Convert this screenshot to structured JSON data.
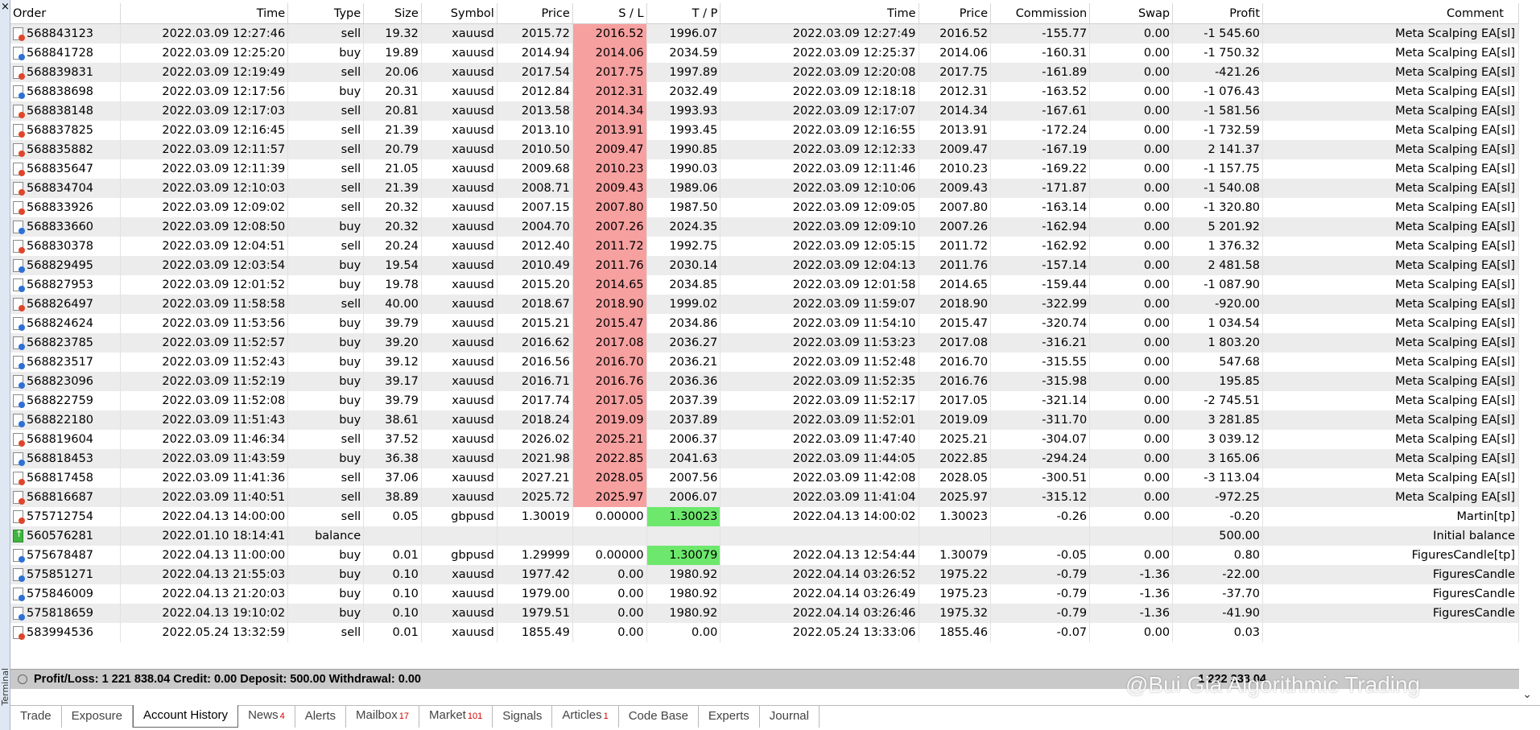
{
  "sidebar": {
    "close_glyph": "×",
    "label": "Terminal"
  },
  "columns": [
    "Order",
    "Time",
    "Type",
    "Size",
    "Symbol",
    "Price",
    "S / L",
    "T / P",
    "Time",
    "Price",
    "Commission",
    "Swap",
    "Profit",
    "Comment"
  ],
  "rows": [
    {
      "icon": "red",
      "order": "568843123",
      "time": "2022.03.09 12:27:46",
      "type": "sell",
      "size": "19.32",
      "symbol": "xauusd",
      "price": "2015.72",
      "sl": "2016.52",
      "tp": "1996.07",
      "close_time": "2022.03.09 12:27:49",
      "close_price": "2016.52",
      "commission": "-155.77",
      "swap": "0.00",
      "profit": "-1 545.60",
      "comment": "Meta Scalping EA[sl]",
      "sl_hit": true,
      "tp_hit": false
    },
    {
      "icon": "blue",
      "order": "568841728",
      "time": "2022.03.09 12:25:20",
      "type": "buy",
      "size": "19.89",
      "symbol": "xauusd",
      "price": "2014.94",
      "sl": "2014.06",
      "tp": "2034.59",
      "close_time": "2022.03.09 12:25:37",
      "close_price": "2014.06",
      "commission": "-160.31",
      "swap": "0.00",
      "profit": "-1 750.32",
      "comment": "Meta Scalping EA[sl]",
      "sl_hit": true,
      "tp_hit": false
    },
    {
      "icon": "red",
      "order": "568839831",
      "time": "2022.03.09 12:19:49",
      "type": "sell",
      "size": "20.06",
      "symbol": "xauusd",
      "price": "2017.54",
      "sl": "2017.75",
      "tp": "1997.89",
      "close_time": "2022.03.09 12:20:08",
      "close_price": "2017.75",
      "commission": "-161.89",
      "swap": "0.00",
      "profit": "-421.26",
      "comment": "Meta Scalping EA[sl]",
      "sl_hit": true,
      "tp_hit": false
    },
    {
      "icon": "blue",
      "order": "568838698",
      "time": "2022.03.09 12:17:56",
      "type": "buy",
      "size": "20.31",
      "symbol": "xauusd",
      "price": "2012.84",
      "sl": "2012.31",
      "tp": "2032.49",
      "close_time": "2022.03.09 12:18:18",
      "close_price": "2012.31",
      "commission": "-163.52",
      "swap": "0.00",
      "profit": "-1 076.43",
      "comment": "Meta Scalping EA[sl]",
      "sl_hit": true,
      "tp_hit": false
    },
    {
      "icon": "red",
      "order": "568838148",
      "time": "2022.03.09 12:17:03",
      "type": "sell",
      "size": "20.81",
      "symbol": "xauusd",
      "price": "2013.58",
      "sl": "2014.34",
      "tp": "1993.93",
      "close_time": "2022.03.09 12:17:07",
      "close_price": "2014.34",
      "commission": "-167.61",
      "swap": "0.00",
      "profit": "-1 581.56",
      "comment": "Meta Scalping EA[sl]",
      "sl_hit": true,
      "tp_hit": false
    },
    {
      "icon": "red",
      "order": "568837825",
      "time": "2022.03.09 12:16:45",
      "type": "sell",
      "size": "21.39",
      "symbol": "xauusd",
      "price": "2013.10",
      "sl": "2013.91",
      "tp": "1993.45",
      "close_time": "2022.03.09 12:16:55",
      "close_price": "2013.91",
      "commission": "-172.24",
      "swap": "0.00",
      "profit": "-1 732.59",
      "comment": "Meta Scalping EA[sl]",
      "sl_hit": true,
      "tp_hit": false
    },
    {
      "icon": "red",
      "order": "568835882",
      "time": "2022.03.09 12:11:57",
      "type": "sell",
      "size": "20.79",
      "symbol": "xauusd",
      "price": "2010.50",
      "sl": "2009.47",
      "tp": "1990.85",
      "close_time": "2022.03.09 12:12:33",
      "close_price": "2009.47",
      "commission": "-167.19",
      "swap": "0.00",
      "profit": "2 141.37",
      "comment": "Meta Scalping EA[sl]",
      "sl_hit": true,
      "tp_hit": false
    },
    {
      "icon": "red",
      "order": "568835647",
      "time": "2022.03.09 12:11:39",
      "type": "sell",
      "size": "21.05",
      "symbol": "xauusd",
      "price": "2009.68",
      "sl": "2010.23",
      "tp": "1990.03",
      "close_time": "2022.03.09 12:11:46",
      "close_price": "2010.23",
      "commission": "-169.22",
      "swap": "0.00",
      "profit": "-1 157.75",
      "comment": "Meta Scalping EA[sl]",
      "sl_hit": true,
      "tp_hit": false
    },
    {
      "icon": "red",
      "order": "568834704",
      "time": "2022.03.09 12:10:03",
      "type": "sell",
      "size": "21.39",
      "symbol": "xauusd",
      "price": "2008.71",
      "sl": "2009.43",
      "tp": "1989.06",
      "close_time": "2022.03.09 12:10:06",
      "close_price": "2009.43",
      "commission": "-171.87",
      "swap": "0.00",
      "profit": "-1 540.08",
      "comment": "Meta Scalping EA[sl]",
      "sl_hit": true,
      "tp_hit": false
    },
    {
      "icon": "red",
      "order": "568833926",
      "time": "2022.03.09 12:09:02",
      "type": "sell",
      "size": "20.32",
      "symbol": "xauusd",
      "price": "2007.15",
      "sl": "2007.80",
      "tp": "1987.50",
      "close_time": "2022.03.09 12:09:05",
      "close_price": "2007.80",
      "commission": "-163.14",
      "swap": "0.00",
      "profit": "-1 320.80",
      "comment": "Meta Scalping EA[sl]",
      "sl_hit": true,
      "tp_hit": false
    },
    {
      "icon": "blue",
      "order": "568833660",
      "time": "2022.03.09 12:08:50",
      "type": "buy",
      "size": "20.32",
      "symbol": "xauusd",
      "price": "2004.70",
      "sl": "2007.26",
      "tp": "2024.35",
      "close_time": "2022.03.09 12:09:10",
      "close_price": "2007.26",
      "commission": "-162.94",
      "swap": "0.00",
      "profit": "5 201.92",
      "comment": "Meta Scalping EA[sl]",
      "sl_hit": true,
      "tp_hit": false
    },
    {
      "icon": "red",
      "order": "568830378",
      "time": "2022.03.09 12:04:51",
      "type": "sell",
      "size": "20.24",
      "symbol": "xauusd",
      "price": "2012.40",
      "sl": "2011.72",
      "tp": "1992.75",
      "close_time": "2022.03.09 12:05:15",
      "close_price": "2011.72",
      "commission": "-162.92",
      "swap": "0.00",
      "profit": "1 376.32",
      "comment": "Meta Scalping EA[sl]",
      "sl_hit": true,
      "tp_hit": false
    },
    {
      "icon": "blue",
      "order": "568829495",
      "time": "2022.03.09 12:03:54",
      "type": "buy",
      "size": "19.54",
      "symbol": "xauusd",
      "price": "2010.49",
      "sl": "2011.76",
      "tp": "2030.14",
      "close_time": "2022.03.09 12:04:13",
      "close_price": "2011.76",
      "commission": "-157.14",
      "swap": "0.00",
      "profit": "2 481.58",
      "comment": "Meta Scalping EA[sl]",
      "sl_hit": true,
      "tp_hit": false
    },
    {
      "icon": "blue",
      "order": "568827953",
      "time": "2022.03.09 12:01:52",
      "type": "buy",
      "size": "19.78",
      "symbol": "xauusd",
      "price": "2015.20",
      "sl": "2014.65",
      "tp": "2034.85",
      "close_time": "2022.03.09 12:01:58",
      "close_price": "2014.65",
      "commission": "-159.44",
      "swap": "0.00",
      "profit": "-1 087.90",
      "comment": "Meta Scalping EA[sl]",
      "sl_hit": true,
      "tp_hit": false
    },
    {
      "icon": "red",
      "order": "568826497",
      "time": "2022.03.09 11:58:58",
      "type": "sell",
      "size": "40.00",
      "symbol": "xauusd",
      "price": "2018.67",
      "sl": "2018.90",
      "tp": "1999.02",
      "close_time": "2022.03.09 11:59:07",
      "close_price": "2018.90",
      "commission": "-322.99",
      "swap": "0.00",
      "profit": "-920.00",
      "comment": "Meta Scalping EA[sl]",
      "sl_hit": true,
      "tp_hit": false
    },
    {
      "icon": "blue",
      "order": "568824624",
      "time": "2022.03.09 11:53:56",
      "type": "buy",
      "size": "39.79",
      "symbol": "xauusd",
      "price": "2015.21",
      "sl": "2015.47",
      "tp": "2034.86",
      "close_time": "2022.03.09 11:54:10",
      "close_price": "2015.47",
      "commission": "-320.74",
      "swap": "0.00",
      "profit": "1 034.54",
      "comment": "Meta Scalping EA[sl]",
      "sl_hit": true,
      "tp_hit": false
    },
    {
      "icon": "blue",
      "order": "568823785",
      "time": "2022.03.09 11:52:57",
      "type": "buy",
      "size": "39.20",
      "symbol": "xauusd",
      "price": "2016.62",
      "sl": "2017.08",
      "tp": "2036.27",
      "close_time": "2022.03.09 11:53:23",
      "close_price": "2017.08",
      "commission": "-316.21",
      "swap": "0.00",
      "profit": "1 803.20",
      "comment": "Meta Scalping EA[sl]",
      "sl_hit": true,
      "tp_hit": false
    },
    {
      "icon": "blue",
      "order": "568823517",
      "time": "2022.03.09 11:52:43",
      "type": "buy",
      "size": "39.12",
      "symbol": "xauusd",
      "price": "2016.56",
      "sl": "2016.70",
      "tp": "2036.21",
      "close_time": "2022.03.09 11:52:48",
      "close_price": "2016.70",
      "commission": "-315.55",
      "swap": "0.00",
      "profit": "547.68",
      "comment": "Meta Scalping EA[sl]",
      "sl_hit": true,
      "tp_hit": false
    },
    {
      "icon": "blue",
      "order": "568823096",
      "time": "2022.03.09 11:52:19",
      "type": "buy",
      "size": "39.17",
      "symbol": "xauusd",
      "price": "2016.71",
      "sl": "2016.76",
      "tp": "2036.36",
      "close_time": "2022.03.09 11:52:35",
      "close_price": "2016.76",
      "commission": "-315.98",
      "swap": "0.00",
      "profit": "195.85",
      "comment": "Meta Scalping EA[sl]",
      "sl_hit": true,
      "tp_hit": false
    },
    {
      "icon": "blue",
      "order": "568822759",
      "time": "2022.03.09 11:52:08",
      "type": "buy",
      "size": "39.79",
      "symbol": "xauusd",
      "price": "2017.74",
      "sl": "2017.05",
      "tp": "2037.39",
      "close_time": "2022.03.09 11:52:17",
      "close_price": "2017.05",
      "commission": "-321.14",
      "swap": "0.00",
      "profit": "-2 745.51",
      "comment": "Meta Scalping EA[sl]",
      "sl_hit": true,
      "tp_hit": false
    },
    {
      "icon": "blue",
      "order": "568822180",
      "time": "2022.03.09 11:51:43",
      "type": "buy",
      "size": "38.61",
      "symbol": "xauusd",
      "price": "2018.24",
      "sl": "2019.09",
      "tp": "2037.89",
      "close_time": "2022.03.09 11:52:01",
      "close_price": "2019.09",
      "commission": "-311.70",
      "swap": "0.00",
      "profit": "3 281.85",
      "comment": "Meta Scalping EA[sl]",
      "sl_hit": true,
      "tp_hit": false
    },
    {
      "icon": "red",
      "order": "568819604",
      "time": "2022.03.09 11:46:34",
      "type": "sell",
      "size": "37.52",
      "symbol": "xauusd",
      "price": "2026.02",
      "sl": "2025.21",
      "tp": "2006.37",
      "close_time": "2022.03.09 11:47:40",
      "close_price": "2025.21",
      "commission": "-304.07",
      "swap": "0.00",
      "profit": "3 039.12",
      "comment": "Meta Scalping EA[sl]",
      "sl_hit": true,
      "tp_hit": false
    },
    {
      "icon": "blue",
      "order": "568818453",
      "time": "2022.03.09 11:43:59",
      "type": "buy",
      "size": "36.38",
      "symbol": "xauusd",
      "price": "2021.98",
      "sl": "2022.85",
      "tp": "2041.63",
      "close_time": "2022.03.09 11:44:05",
      "close_price": "2022.85",
      "commission": "-294.24",
      "swap": "0.00",
      "profit": "3 165.06",
      "comment": "Meta Scalping EA[sl]",
      "sl_hit": true,
      "tp_hit": false
    },
    {
      "icon": "red",
      "order": "568817458",
      "time": "2022.03.09 11:41:36",
      "type": "sell",
      "size": "37.06",
      "symbol": "xauusd",
      "price": "2027.21",
      "sl": "2028.05",
      "tp": "2007.56",
      "close_time": "2022.03.09 11:42:08",
      "close_price": "2028.05",
      "commission": "-300.51",
      "swap": "0.00",
      "profit": "-3 113.04",
      "comment": "Meta Scalping EA[sl]",
      "sl_hit": true,
      "tp_hit": false
    },
    {
      "icon": "red",
      "order": "568816687",
      "time": "2022.03.09 11:40:51",
      "type": "sell",
      "size": "38.89",
      "symbol": "xauusd",
      "price": "2025.72",
      "sl": "2025.97",
      "tp": "2006.07",
      "close_time": "2022.03.09 11:41:04",
      "close_price": "2025.97",
      "commission": "-315.12",
      "swap": "0.00",
      "profit": "-972.25",
      "comment": "Meta Scalping EA[sl]",
      "sl_hit": true,
      "tp_hit": false
    },
    {
      "icon": "red",
      "order": "575712754",
      "time": "2022.04.13 14:00:00",
      "type": "sell",
      "size": "0.05",
      "symbol": "gbpusd",
      "price": "1.30019",
      "sl": "0.00000",
      "tp": "1.30023",
      "close_time": "2022.04.13 14:00:02",
      "close_price": "1.30023",
      "commission": "-0.26",
      "swap": "0.00",
      "profit": "-0.20",
      "comment": "Martin[tp]",
      "sl_hit": false,
      "tp_hit": true
    },
    {
      "icon": "green",
      "order": "560576281",
      "time": "2022.01.10 18:14:41",
      "type": "balance",
      "size": "",
      "symbol": "",
      "price": "",
      "sl": "",
      "tp": "",
      "close_time": "",
      "close_price": "",
      "commission": "",
      "swap": "",
      "profit": "500.00",
      "comment": "Initial balance",
      "sl_hit": false,
      "tp_hit": false
    },
    {
      "icon": "blue",
      "order": "575678487",
      "time": "2022.04.13 11:00:00",
      "type": "buy",
      "size": "0.01",
      "symbol": "gbpusd",
      "price": "1.29999",
      "sl": "0.00000",
      "tp": "1.30079",
      "close_time": "2022.04.13 12:54:44",
      "close_price": "1.30079",
      "commission": "-0.05",
      "swap": "0.00",
      "profit": "0.80",
      "comment": "FiguresCandle[tp]",
      "sl_hit": false,
      "tp_hit": true
    },
    {
      "icon": "blue",
      "order": "575851271",
      "time": "2022.04.13 21:55:03",
      "type": "buy",
      "size": "0.10",
      "symbol": "xauusd",
      "price": "1977.42",
      "sl": "0.00",
      "tp": "1980.92",
      "close_time": "2022.04.14 03:26:52",
      "close_price": "1975.22",
      "commission": "-0.79",
      "swap": "-1.36",
      "profit": "-22.00",
      "comment": "FiguresCandle",
      "sl_hit": false,
      "tp_hit": false
    },
    {
      "icon": "blue",
      "order": "575846009",
      "time": "2022.04.13 21:20:03",
      "type": "buy",
      "size": "0.10",
      "symbol": "xauusd",
      "price": "1979.00",
      "sl": "0.00",
      "tp": "1980.92",
      "close_time": "2022.04.14 03:26:49",
      "close_price": "1975.23",
      "commission": "-0.79",
      "swap": "-1.36",
      "profit": "-37.70",
      "comment": "FiguresCandle",
      "sl_hit": false,
      "tp_hit": false
    },
    {
      "icon": "blue",
      "order": "575818659",
      "time": "2022.04.13 19:10:02",
      "type": "buy",
      "size": "0.10",
      "symbol": "xauusd",
      "price": "1979.51",
      "sl": "0.00",
      "tp": "1980.92",
      "close_time": "2022.04.14 03:26:46",
      "close_price": "1975.32",
      "commission": "-0.79",
      "swap": "-1.36",
      "profit": "-41.90",
      "comment": "FiguresCandle",
      "sl_hit": false,
      "tp_hit": false
    },
    {
      "icon": "red",
      "order": "583994536",
      "time": "2022.05.24 13:32:59",
      "type": "sell",
      "size": "0.01",
      "symbol": "xauusd",
      "price": "1855.49",
      "sl": "0.00",
      "tp": "0.00",
      "close_time": "2022.05.24 13:33:06",
      "close_price": "1855.46",
      "commission": "-0.07",
      "swap": "0.00",
      "profit": "0.03",
      "comment": "",
      "sl_hit": false,
      "tp_hit": false
    }
  ],
  "summary": {
    "text": "Profit/Loss: 1 221 838.04  Credit: 0.00  Deposit: 500.00  Withdrawal: 0.00",
    "profit_total": "1 222 338.04"
  },
  "tabs": [
    {
      "label": "Trade",
      "badge": ""
    },
    {
      "label": "Exposure",
      "badge": ""
    },
    {
      "label": "Account History",
      "badge": "",
      "active": true
    },
    {
      "label": "News",
      "badge": "4"
    },
    {
      "label": "Alerts",
      "badge": ""
    },
    {
      "label": "Mailbox",
      "badge": "17"
    },
    {
      "label": "Market",
      "badge": "101"
    },
    {
      "label": "Signals",
      "badge": ""
    },
    {
      "label": "Articles",
      "badge": "1"
    },
    {
      "label": "Code Base",
      "badge": ""
    },
    {
      "label": "Experts",
      "badge": ""
    },
    {
      "label": "Journal",
      "badge": ""
    }
  ],
  "watermark": "@Bui Gia Algorithmic Trading",
  "colors": {
    "sl_hit": "#f7a0a0",
    "tp_hit": "#6de86d",
    "row_alt": "#ececec",
    "summary_bg": "#c9c9c9"
  }
}
